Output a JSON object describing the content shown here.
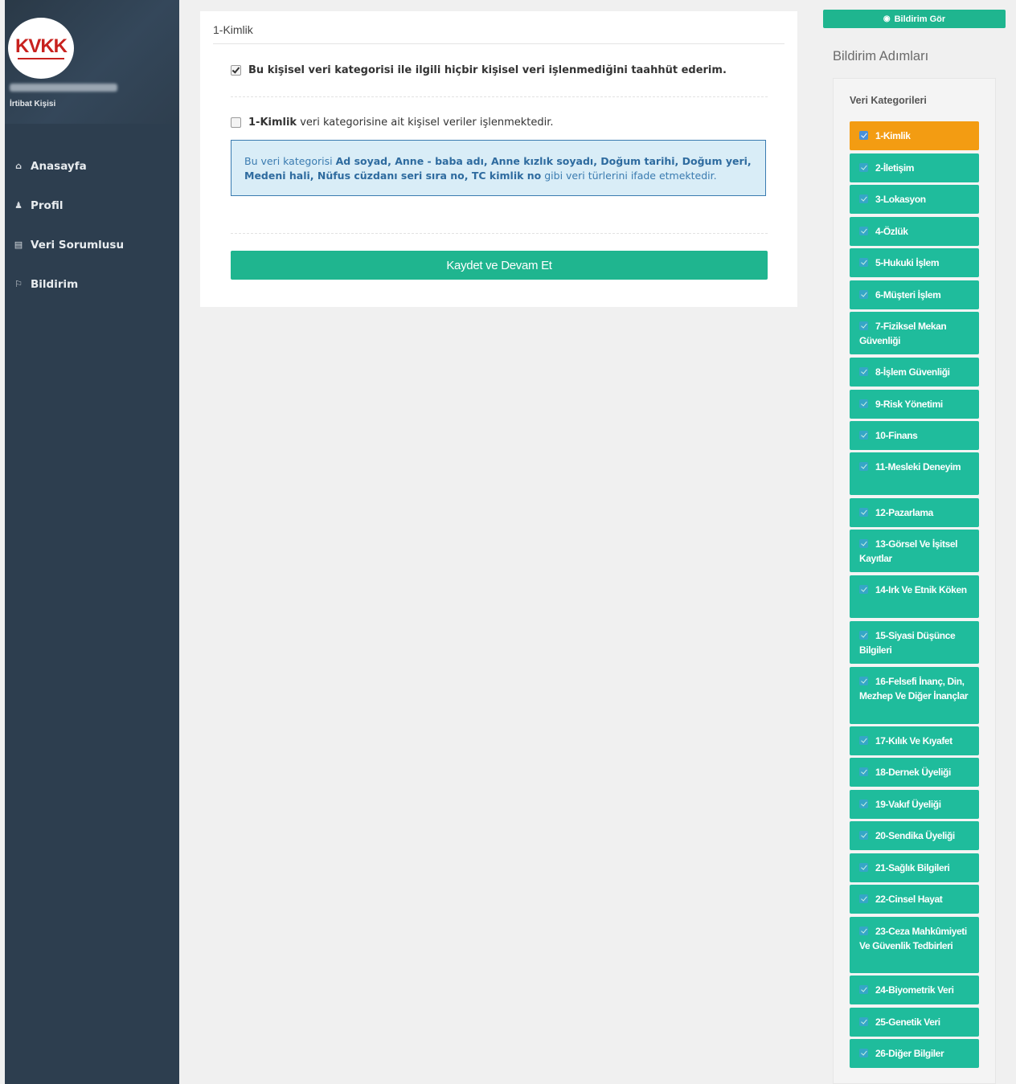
{
  "sidebar": {
    "logo_text": "KVKK",
    "role": "İrtibat Kişisi",
    "nav": [
      {
        "label": "Anasayfa",
        "icon": "home-icon"
      },
      {
        "label": "Profil",
        "icon": "user-icon"
      },
      {
        "label": "Veri Sorumlusu",
        "icon": "database-icon"
      },
      {
        "label": "Bildirim",
        "icon": "bullhorn-icon"
      }
    ]
  },
  "main": {
    "card_title": "1-Kimlik",
    "commit_label": "Bu kişisel veri kategorisi ile ilgili hiçbir kişisel veri işlenmediğini taahhüt ederim.",
    "commit_checked": true,
    "process_category": "1-Kimlik",
    "process_label_rest": "veri kategorisine ait kişisel veriler işlenmektedir.",
    "process_checked": false,
    "info": {
      "prefix": "Bu veri kategorisi",
      "types": "Ad soyad, Anne - baba adı, Anne kızlık soyadı, Doğum tarihi, Doğum yeri, Medeni hali, Nüfus cüzdanı seri sıra no, TC kimlik no",
      "suffix": "gibi veri türlerini ifade etmektedir."
    },
    "save_label": "Kaydet ve Devam Et"
  },
  "right": {
    "view_label": "Bildirim Gör",
    "steps_title": "Bildirim Adımları",
    "steps_subtitle": "Veri Kategorileri",
    "steps": [
      "1-Kimlik",
      "2-İletişim",
      "3-Lokasyon",
      "4-Özlük",
      "5-Hukuki İşlem",
      "6-Müşteri İşlem",
      "7-Fiziksel Mekan Güvenliği",
      "8-İşlem Güvenliği",
      "9-Risk Yönetimi",
      "10-Finans",
      "11-Mesleki Deneyim",
      "12-Pazarlama",
      "13-Görsel Ve İşitsel Kayıtlar",
      "14-Irk Ve Etnik Köken",
      "15-Siyasi Düşünce Bilgileri",
      "16-Felsefi İnanç, Din, Mezhep Ve Diğer İnançlar",
      "17-Kılık Ve Kıyafet",
      "18-Dernek Üyeliği",
      "19-Vakıf Üyeliği",
      "20-Sendika Üyeliği",
      "21-Sağlık Bilgileri",
      "22-Cinsel Hayat",
      "23-Ceza Mahkûmiyeti Ve Güvenlik Tedbirleri",
      "24-Biyometrik Veri",
      "25-Genetik Veri",
      "26-Diğer Bilgiler"
    ],
    "active_step": 0,
    "colors": {
      "accent": "#1fb58f",
      "active": "#f39c12",
      "sidebar": "#2d3e4f"
    }
  }
}
